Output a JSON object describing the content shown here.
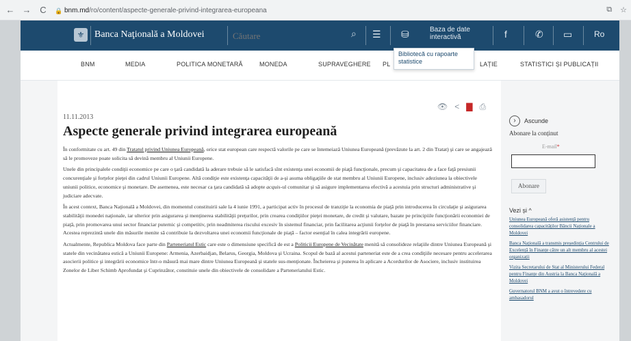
{
  "browser": {
    "host": "bnm.md",
    "path": "/ro/content/aspecte-generale-privind-integrarea-europeana"
  },
  "header": {
    "bank_name": "Banca Naţională a Moldovei",
    "search_placeholder": "Căutare",
    "database_label": "Baza de date interactivă",
    "language": "Ro",
    "dropdown_text": "Bibliotecă cu rapoarte statistice"
  },
  "nav": [
    "BNM",
    "MEDIA",
    "POLITICA MONETARĂ",
    "MONEDA",
    "SUPRAVEGHERE",
    "PL",
    "LAȚIE",
    "STATISTICI ȘI PUBLICAȚII"
  ],
  "article": {
    "date": "11.11.2013",
    "title": "Aspecte generale privind integrarea europeană",
    "p1_a": "În conformitate cu art. 49 din ",
    "p1_link": "Tratatul privind Uniunea Europeană",
    "p1_b": ", orice stat european care respectă valorile pe care se întemeiază Uniunea Europeană (prevăzute la art. 2 din Tratat) şi care se angajează să le promoveze poate solicita să devină membru al Uniunii Europene.",
    "p2_a": "Unele din principalele condiţii economice pe care o ţară candidată la aderare trebuie să le satisfacă sînt existenţa unei economii de piaţă funcţionale, precum şi capacitatea de a face faţă presiunii concurenţiale şi forţelor pieţei din cadrul Uniunii Europene. Altă condiţie este existenţa capacităţii de a-şi asuma obligaţiile de stat membru al Uniunii Europene, inclusiv adeziunea la obiectivele uniunii politice, economice şi monetare. De asemenea, este necesar ca ţara candidată să adopte ",
    "p2_em": "acquis",
    "p2_b": "-ul comunitar şi să asigure implementarea efectivă a acestuia prin structuri administrative şi judiciare adecvate.",
    "p3": "În acest context, Banca Naţională a Moldovei, din momentul constituirii sale la 4 iunie 1991, a participat activ în procesul de tranziţie la economia de piaţă prin introducerea în circulaţie şi asigurarea stabilităţii monedei naţionale, iar ulterior prin asigurarea şi menţinerea stabilităţii preţurilor, prin crearea condiţiilor pieţei monetare, de credit şi valutare, bazate pe principiile funcţionării economiei de piaţă, prin promovarea unui sector financiar puternic şi competitiv, prin neadmiterea riscului excesiv în sistemul financiar, prin facilitarea acţiunii forţelor de piaţă în prestarea serviciilor financiare. Acestea reprezintă unele din măsurile menite să contribuie la dezvoltarea unei economii funcţionale de piaţă – factor esenţial în calea integrării europene.",
    "p4_a": "Actualmente, Republica Moldova face parte din ",
    "p4_link1": "Parteneriatul Estic",
    "p4_b": " care este o dimensiune specifică de est a ",
    "p4_link2": "Politicii Europene de Vecinătate",
    "p4_c": " menită să consolideze relaţiile dintre Uniunea Europeană şi statele din vecinătatea estică a Uniunii Europene: Armenia, Azerbaidjan, Belarus, Georgia, Moldova şi Ucraina. Scopul de bază al acestui parteneriat este de a crea condiţiile necesare pentru accelerarea asocierii politice şi integrării economice într-o măsură mai mare dintre Uniunea Europeană şi statele sus-menţionate. Încheierea şi punerea în aplicare a Acordurilor de Asociere, inclusiv instituirea Zonelor de Liber Schimb Aprofundat şi Cuprinzător, constituie unele din obiectivele de consolidare a Parteneriatului Estic."
  },
  "sidebar": {
    "hide_label": "Ascunde",
    "subscribe_title": "Abonare la conținut",
    "email_label": "E-mail",
    "email_required": "*",
    "subscribe_button": "Abonare",
    "see_also": "Vezi și ^",
    "links": [
      "Uniunea Europeană oferă asistență pentru consolidarea capacităților Băncii Naționale a Moldovei",
      "Banca Națională a transmis președinția Centrului de Excelență în Finanțe către un alt membru al acestei organizații",
      "Vizita Secretarului de Stat al Ministerului Federal pentru Finanțe din Austria la Banca Națională a Moldovei",
      "Guvernatorul BNM a avut o întrevedere cu ambasadorul"
    ]
  }
}
